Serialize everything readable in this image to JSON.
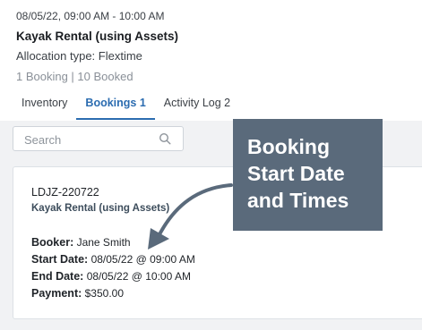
{
  "booking_header": {
    "time_range": "08/05/22, 09:00 AM - 10:00 AM",
    "title": "Kayak Rental (using Assets)",
    "allocation": "Allocation type: Flextime",
    "counts": "1 Booking | 10 Booked"
  },
  "tabs": [
    {
      "label": "Inventory",
      "active": false
    },
    {
      "label": "Bookings 1",
      "active": true
    },
    {
      "label": "Activity Log 2",
      "active": false
    }
  ],
  "search": {
    "placeholder": "Search",
    "icon": "search-icon"
  },
  "booking_card": {
    "reference": "LDJZ-220722",
    "service": "Kayak Rental (using Assets)",
    "booker_label": "Booker:",
    "booker_value": "Jane Smith",
    "start_label": "Start Date:",
    "start_value": "08/05/22 @ 09:00 AM",
    "end_label": "End Date:",
    "end_value": "08/05/22 @ 10:00 AM",
    "payment_label": "Payment:",
    "payment_value": "$350.00"
  },
  "callout": {
    "line1": "Booking",
    "line2": "Start Date",
    "line3": "and Times"
  },
  "colors": {
    "accent": "#2b6cb0",
    "callout_bg": "#5a6a7b",
    "content_bg": "#f1f2f4"
  }
}
